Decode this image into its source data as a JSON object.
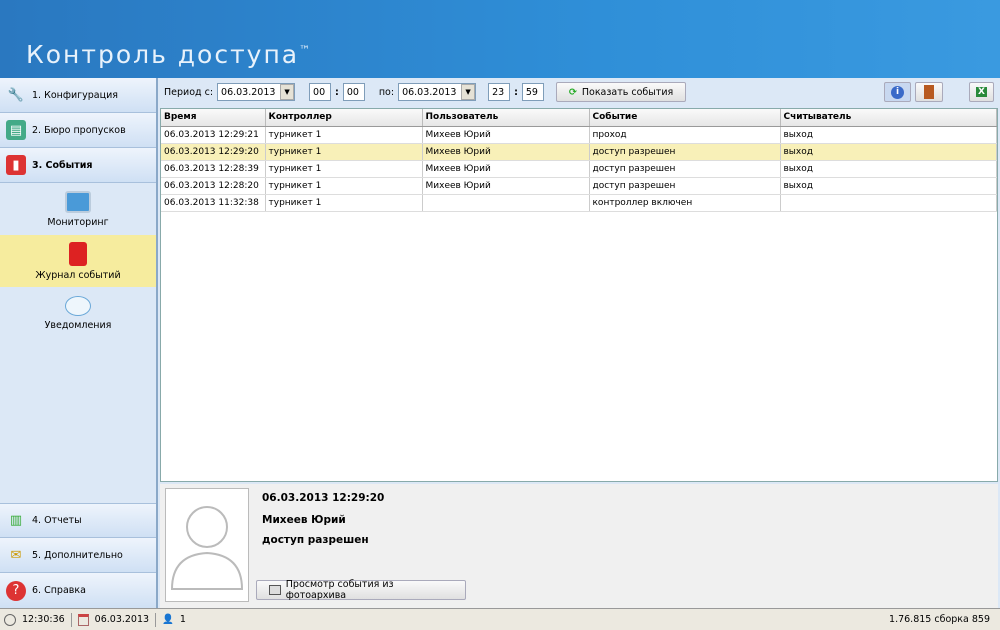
{
  "header": {
    "title": "Контроль доступа",
    "tm": "™"
  },
  "sidebar": {
    "items": [
      {
        "label": "1. Конфигурация",
        "icon": "wrench-icon"
      },
      {
        "label": "2. Бюро пропусков",
        "icon": "id-card-icon"
      },
      {
        "label": "3. События",
        "icon": "journal-icon"
      }
    ],
    "sub": [
      {
        "label": "Мониторинг",
        "icon": "monitor-icon"
      },
      {
        "label": "Журнал событий",
        "icon": "journal-icon"
      },
      {
        "label": "Уведомления",
        "icon": "speech-bubble-icon"
      }
    ],
    "bottom": [
      {
        "label": "4. Отчеты",
        "icon": "chart-icon"
      },
      {
        "label": "5. Дополнительно",
        "icon": "envelope-icon"
      },
      {
        "label": "6. Справка",
        "icon": "help-icon"
      }
    ]
  },
  "toolbar": {
    "period_label": "Период с:",
    "from_date": "06.03.2013",
    "from_h": "00",
    "from_m": "00",
    "to_label": "по:",
    "to_date": "06.03.2013",
    "to_h": "23",
    "to_m": "59",
    "show_button": "Показать события"
  },
  "table": {
    "columns": [
      "Время",
      "Контроллер",
      "Пользователь",
      "Событие",
      "Считыватель"
    ],
    "rows": [
      [
        "06.03.2013 12:29:21",
        "турникет 1",
        "Михеев Юрий",
        "проход",
        "выход"
      ],
      [
        "06.03.2013 12:29:20",
        "турникет 1",
        "Михеев Юрий",
        "доступ разрешен",
        "выход"
      ],
      [
        "06.03.2013 12:28:39",
        "турникет 1",
        "Михеев Юрий",
        "доступ разрешен",
        "выход"
      ],
      [
        "06.03.2013 12:28:20",
        "турникет 1",
        "Михеев Юрий",
        "доступ разрешен",
        "выход"
      ],
      [
        "06.03.2013 11:32:38",
        "турникет 1",
        "",
        "контроллер включен",
        ""
      ]
    ],
    "selected_row": 1
  },
  "detail": {
    "time": "06.03.2013 12:29:20",
    "user": "Михеев Юрий",
    "event": "доступ разрешен",
    "archive_button": "Просмотр события из фотоархива"
  },
  "status": {
    "time": "12:30:36",
    "date": "06.03.2013",
    "users": "1",
    "version": "1.76.815 сборка 859"
  }
}
